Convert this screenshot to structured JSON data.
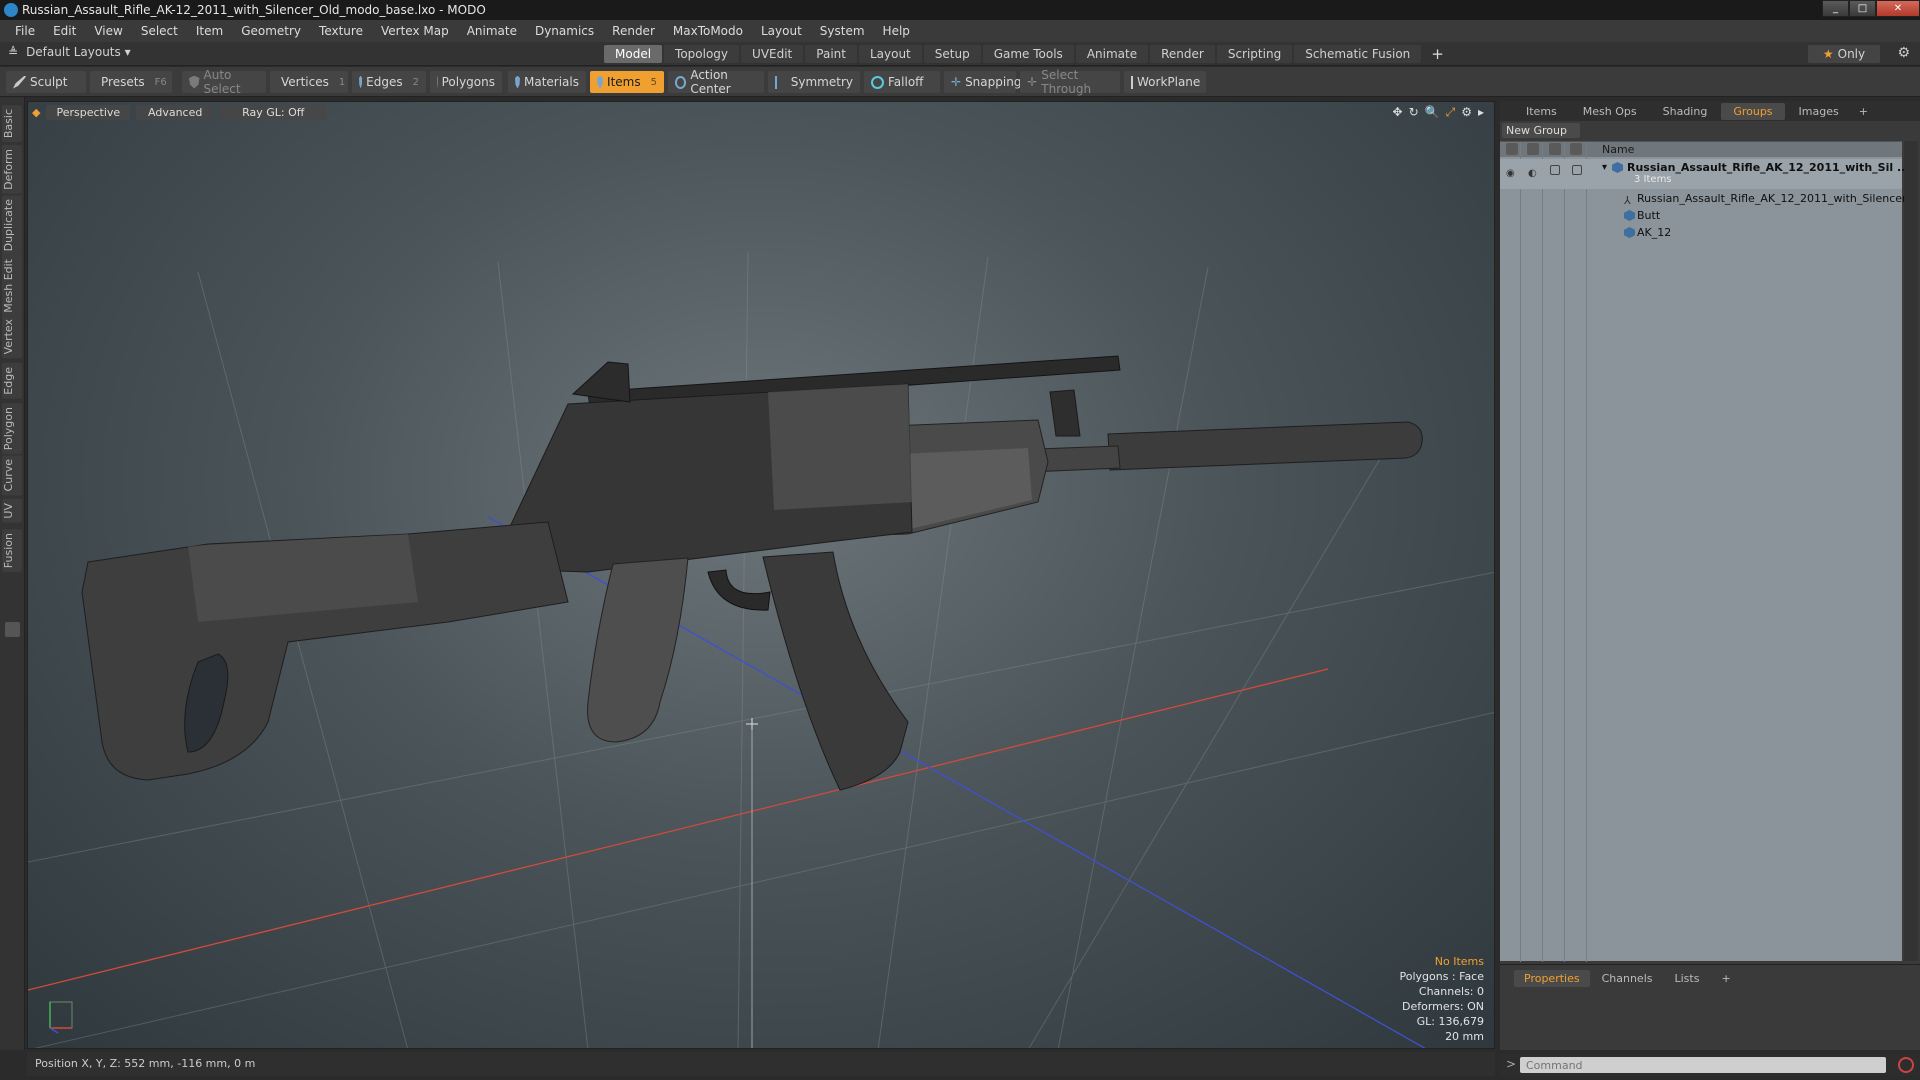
{
  "window": {
    "title": "Russian_Assault_Rifle_AK-12_2011_with_Silencer_Old_modo_base.lxo - MODO",
    "controls": [
      "_",
      "□",
      "✕"
    ]
  },
  "menu": [
    "File",
    "Edit",
    "View",
    "Select",
    "Item",
    "Geometry",
    "Texture",
    "Vertex Map",
    "Animate",
    "Dynamics",
    "Render",
    "MaxToModo",
    "Layout",
    "System",
    "Help"
  ],
  "layout": {
    "selector": "Default Layouts ▾",
    "tabs": [
      "Model",
      "Topology",
      "UVEdit",
      "Paint",
      "Layout",
      "Setup",
      "Game Tools",
      "Animate",
      "Render",
      "Scripting",
      "Schematic Fusion"
    ],
    "active_tab": "Model",
    "add": "+",
    "only_label": "Only"
  },
  "toolbar": {
    "sculpt": "Sculpt",
    "presets": "Presets",
    "presets_key": "F6",
    "auto_select": "Auto Select",
    "vertices": "Vertices",
    "vertices_key": "1",
    "edges": "Edges",
    "edges_key": "2",
    "polygons": "Polygons",
    "materials": "Materials",
    "items": "Items",
    "items_key": "5",
    "action_center": "Action Center",
    "symmetry": "Symmetry",
    "falloff": "Falloff",
    "snapping": "Snapping",
    "select_through": "Select Through",
    "workplane": "WorkPlane"
  },
  "left_tabs": [
    "Basic",
    "Deform",
    "Duplicate",
    "Mesh Edit",
    "Vertex",
    "Edge",
    "Polygon",
    "Curve",
    "UV",
    "Fusion"
  ],
  "viewport": {
    "view": "Perspective",
    "mode": "Advanced",
    "raygl": "Ray GL: Off",
    "info": {
      "selection": "No Items",
      "polygons": "Polygons : Face",
      "channels": "Channels: 0",
      "deformers": "Deformers: ON",
      "gl": "GL: 136,679",
      "scale": "20 mm"
    }
  },
  "status": {
    "position": "Position X, Y, Z:  552 mm, -116 mm, 0 m"
  },
  "right_panel": {
    "tabs": [
      "Items",
      "Mesh Ops",
      "Shading",
      "Groups",
      "Images"
    ],
    "active_tab": "Groups",
    "add": "+",
    "new_group": "New Group",
    "name_header": "Name",
    "group_name": "Russian_Assault_Rifle_AK_12_2011_with_Sil ...",
    "group_count": "3 Items",
    "children": [
      "Russian_Assault_Rifle_AK_12_2011_with_Silencer_...",
      "Butt",
      "AK_12"
    ]
  },
  "props_panel": {
    "tabs": [
      "Properties",
      "Channels",
      "Lists"
    ],
    "active_tab": "Properties",
    "add": "+"
  },
  "command": {
    "prompt": ">",
    "placeholder": "Command"
  }
}
